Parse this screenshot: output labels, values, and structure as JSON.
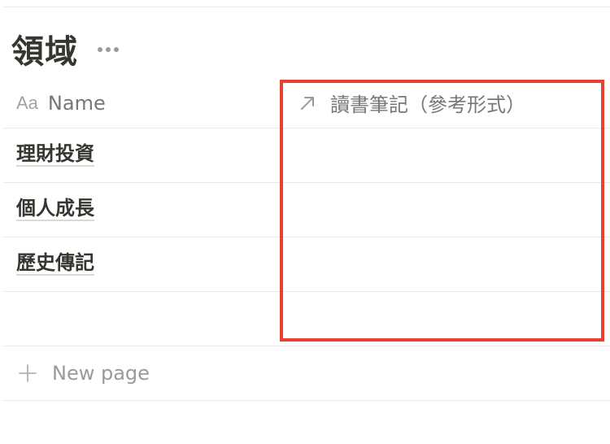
{
  "database": {
    "title": "領域",
    "more_icon": "more-horizontal-icon"
  },
  "table": {
    "columns": [
      {
        "icon": "text-type-icon",
        "icon_text": "Aa",
        "label": "Name"
      },
      {
        "icon": "relation-arrow-icon",
        "label": "讀書筆記（參考形式）"
      }
    ],
    "rows": [
      {
        "name": "理財投資",
        "relation": ""
      },
      {
        "name": "個人成長",
        "relation": ""
      },
      {
        "name": "歷史傳記",
        "relation": ""
      },
      {
        "name": "",
        "relation": ""
      }
    ],
    "new_page_label": "New page",
    "new_page_icon": "plus-icon"
  },
  "highlight": {
    "color": "#e8412f"
  }
}
